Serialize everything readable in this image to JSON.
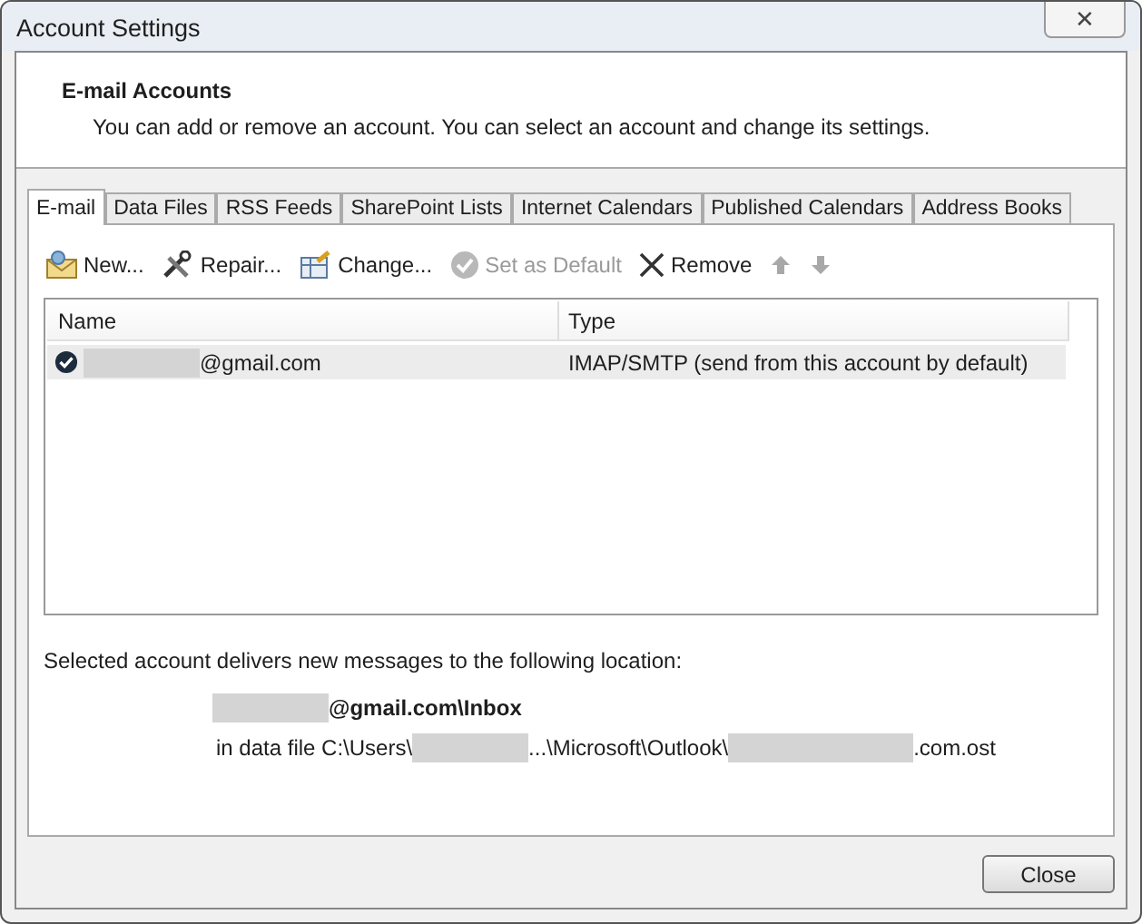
{
  "window": {
    "title": "Account Settings",
    "close": "✕"
  },
  "header": {
    "title": "E-mail Accounts",
    "description": "You can add or remove an account. You can select an account and change its settings."
  },
  "tabs": [
    {
      "label": "E-mail",
      "selected": true
    },
    {
      "label": "Data Files",
      "selected": false
    },
    {
      "label": "RSS Feeds",
      "selected": false
    },
    {
      "label": "SharePoint Lists",
      "selected": false
    },
    {
      "label": "Internet Calendars",
      "selected": false
    },
    {
      "label": "Published Calendars",
      "selected": false
    },
    {
      "label": "Address Books",
      "selected": false
    }
  ],
  "toolbar": [
    {
      "kind": "new",
      "label": "New...",
      "disabled": false
    },
    {
      "kind": "repair",
      "label": "Repair...",
      "disabled": false
    },
    {
      "kind": "change",
      "label": "Change...",
      "disabled": false
    },
    {
      "kind": "default",
      "label": "Set as Default",
      "disabled": true
    },
    {
      "kind": "remove",
      "label": "Remove",
      "disabled": false
    },
    {
      "kind": "up",
      "disabled": true
    },
    {
      "kind": "down",
      "disabled": true
    }
  ],
  "table": {
    "columns": [
      "Name",
      "Type"
    ],
    "rows": [
      {
        "name": [
          {
            "kind": "redacted"
          },
          {
            "kind": "text",
            "text": "@gmail.com"
          }
        ],
        "type": "IMAP/SMTP (send from this account by default)",
        "default": true,
        "selected": true
      }
    ]
  },
  "delivery": {
    "label": "Selected account delivers new messages to the following location:",
    "folder": [
      {
        "kind": "redacted"
      },
      {
        "kind": "text",
        "text": "@gmail.com\\Inbox"
      }
    ],
    "path": [
      {
        "kind": "text",
        "text": "in data file C:\\Users\\"
      },
      {
        "kind": "redacted"
      },
      {
        "kind": "text",
        "text": "...\\Microsoft\\Outlook\\"
      },
      {
        "kind": "redacted",
        "wide": true
      },
      {
        "kind": "text",
        "text": ".com.ost"
      }
    ]
  },
  "buttons": [
    "Close"
  ]
}
